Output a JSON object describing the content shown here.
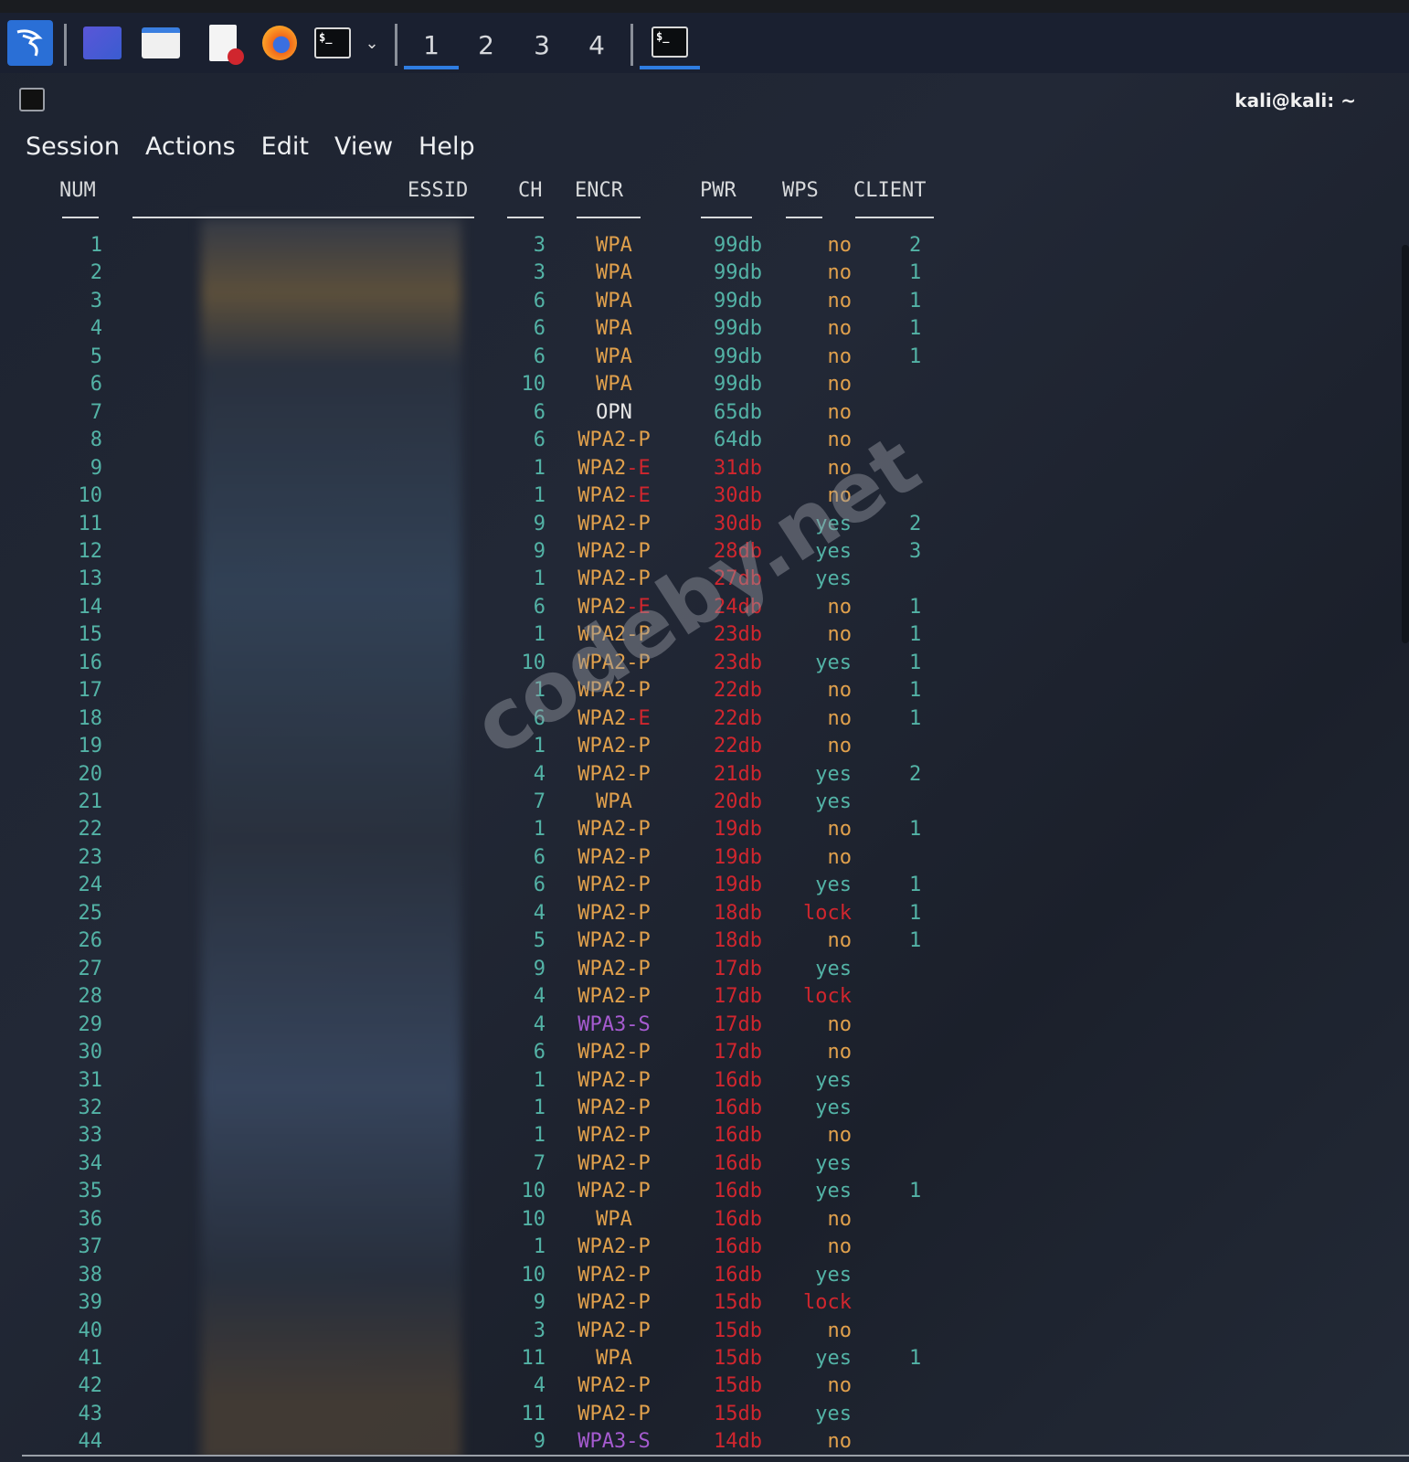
{
  "taskbar": {
    "workspaces": [
      "1",
      "2",
      "3",
      "4"
    ],
    "active_workspace": "1",
    "terminal_icon_text": "$_",
    "accent": "#2f7de1"
  },
  "window": {
    "title": "kali@kali: ~"
  },
  "menu": [
    "Session",
    "Actions",
    "Edit",
    "View",
    "Help"
  ],
  "table": {
    "headers": {
      "num": "NUM",
      "essid": "ESSID",
      "ch": "CH",
      "encr": "ENCR",
      "pwr": "PWR",
      "wps": "WPS",
      "client": "CLIENT"
    },
    "rows": [
      {
        "num": "1",
        "ch": "3",
        "encr": "WPA",
        "pwr": "99db",
        "wps": "no",
        "client": "2"
      },
      {
        "num": "2",
        "ch": "3",
        "encr": "WPA",
        "pwr": "99db",
        "wps": "no",
        "client": "1"
      },
      {
        "num": "3",
        "ch": "6",
        "encr": "WPA",
        "pwr": "99db",
        "wps": "no",
        "client": "1"
      },
      {
        "num": "4",
        "ch": "6",
        "encr": "WPA",
        "pwr": "99db",
        "wps": "no",
        "client": "1"
      },
      {
        "num": "5",
        "ch": "6",
        "encr": "WPA",
        "pwr": "99db",
        "wps": "no",
        "client": "1"
      },
      {
        "num": "6",
        "ch": "10",
        "encr": "WPA",
        "pwr": "99db",
        "wps": "no",
        "client": ""
      },
      {
        "num": "7",
        "ch": "6",
        "encr": "OPN",
        "pwr": "65db",
        "wps": "no",
        "client": ""
      },
      {
        "num": "8",
        "ch": "6",
        "encr": "WPA2-P",
        "pwr": "64db",
        "wps": "no",
        "client": ""
      },
      {
        "num": "9",
        "ch": "1",
        "encr": "WPA2-E",
        "pwr": "31db",
        "wps": "no",
        "client": ""
      },
      {
        "num": "10",
        "ch": "1",
        "encr": "WPA2-E",
        "pwr": "30db",
        "wps": "no",
        "client": ""
      },
      {
        "num": "11",
        "ch": "9",
        "encr": "WPA2-P",
        "pwr": "30db",
        "wps": "yes",
        "client": "2"
      },
      {
        "num": "12",
        "ch": "9",
        "encr": "WPA2-P",
        "pwr": "28db",
        "wps": "yes",
        "client": "3"
      },
      {
        "num": "13",
        "ch": "1",
        "encr": "WPA2-P",
        "pwr": "27db",
        "wps": "yes",
        "client": ""
      },
      {
        "num": "14",
        "ch": "6",
        "encr": "WPA2-E",
        "pwr": "24db",
        "wps": "no",
        "client": "1"
      },
      {
        "num": "15",
        "ch": "1",
        "encr": "WPA2-P",
        "pwr": "23db",
        "wps": "no",
        "client": "1"
      },
      {
        "num": "16",
        "ch": "10",
        "encr": "WPA2-P",
        "pwr": "23db",
        "wps": "yes",
        "client": "1"
      },
      {
        "num": "17",
        "ch": "1",
        "encr": "WPA2-P",
        "pwr": "22db",
        "wps": "no",
        "client": "1"
      },
      {
        "num": "18",
        "ch": "6",
        "encr": "WPA2-E",
        "pwr": "22db",
        "wps": "no",
        "client": "1"
      },
      {
        "num": "19",
        "ch": "1",
        "encr": "WPA2-P",
        "pwr": "22db",
        "wps": "no",
        "client": ""
      },
      {
        "num": "20",
        "ch": "4",
        "encr": "WPA2-P",
        "pwr": "21db",
        "wps": "yes",
        "client": "2"
      },
      {
        "num": "21",
        "ch": "7",
        "encr": "WPA",
        "pwr": "20db",
        "wps": "yes",
        "client": ""
      },
      {
        "num": "22",
        "ch": "1",
        "encr": "WPA2-P",
        "pwr": "19db",
        "wps": "no",
        "client": "1"
      },
      {
        "num": "23",
        "ch": "6",
        "encr": "WPA2-P",
        "pwr": "19db",
        "wps": "no",
        "client": ""
      },
      {
        "num": "24",
        "ch": "6",
        "encr": "WPA2-P",
        "pwr": "19db",
        "wps": "yes",
        "client": "1"
      },
      {
        "num": "25",
        "ch": "4",
        "encr": "WPA2-P",
        "pwr": "18db",
        "wps": "lock",
        "client": "1"
      },
      {
        "num": "26",
        "ch": "5",
        "encr": "WPA2-P",
        "pwr": "18db",
        "wps": "no",
        "client": "1"
      },
      {
        "num": "27",
        "ch": "9",
        "encr": "WPA2-P",
        "pwr": "17db",
        "wps": "yes",
        "client": ""
      },
      {
        "num": "28",
        "ch": "4",
        "encr": "WPA2-P",
        "pwr": "17db",
        "wps": "lock",
        "client": ""
      },
      {
        "num": "29",
        "ch": "4",
        "encr": "WPA3-S",
        "pwr": "17db",
        "wps": "no",
        "client": ""
      },
      {
        "num": "30",
        "ch": "6",
        "encr": "WPA2-P",
        "pwr": "17db",
        "wps": "no",
        "client": ""
      },
      {
        "num": "31",
        "ch": "1",
        "encr": "WPA2-P",
        "pwr": "16db",
        "wps": "yes",
        "client": ""
      },
      {
        "num": "32",
        "ch": "1",
        "encr": "WPA2-P",
        "pwr": "16db",
        "wps": "yes",
        "client": ""
      },
      {
        "num": "33",
        "ch": "1",
        "encr": "WPA2-P",
        "pwr": "16db",
        "wps": "no",
        "client": ""
      },
      {
        "num": "34",
        "ch": "7",
        "encr": "WPA2-P",
        "pwr": "16db",
        "wps": "yes",
        "client": ""
      },
      {
        "num": "35",
        "ch": "10",
        "encr": "WPA2-P",
        "pwr": "16db",
        "wps": "yes",
        "client": "1"
      },
      {
        "num": "36",
        "ch": "10",
        "encr": "WPA",
        "pwr": "16db",
        "wps": "no",
        "client": ""
      },
      {
        "num": "37",
        "ch": "1",
        "encr": "WPA2-P",
        "pwr": "16db",
        "wps": "no",
        "client": ""
      },
      {
        "num": "38",
        "ch": "10",
        "encr": "WPA2-P",
        "pwr": "16db",
        "wps": "yes",
        "client": ""
      },
      {
        "num": "39",
        "ch": "9",
        "encr": "WPA2-P",
        "pwr": "15db",
        "wps": "lock",
        "client": ""
      },
      {
        "num": "40",
        "ch": "3",
        "encr": "WPA2-P",
        "pwr": "15db",
        "wps": "no",
        "client": ""
      },
      {
        "num": "41",
        "ch": "11",
        "encr": "WPA",
        "pwr": "15db",
        "wps": "yes",
        "client": "1"
      },
      {
        "num": "42",
        "ch": "4",
        "encr": "WPA2-P",
        "pwr": "15db",
        "wps": "no",
        "client": ""
      },
      {
        "num": "43",
        "ch": "11",
        "encr": "WPA2-P",
        "pwr": "15db",
        "wps": "yes",
        "client": ""
      },
      {
        "num": "44",
        "ch": "9",
        "encr": "WPA3-S",
        "pwr": "14db",
        "wps": "no",
        "client": ""
      }
    ]
  },
  "watermark": "codeby.net",
  "colors": {
    "teal": "#53b3a6",
    "orange": "#e0a04c",
    "red": "#d0262e",
    "purple": "#a65bd0"
  }
}
